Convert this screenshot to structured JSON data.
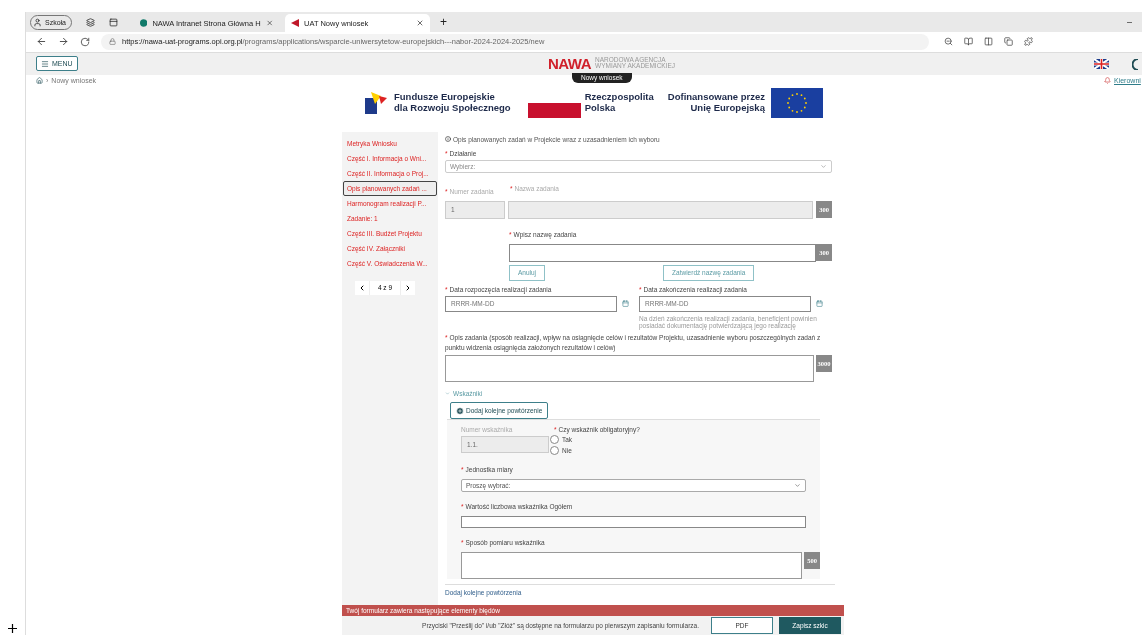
{
  "browser": {
    "profile": "Szkoła",
    "tabs": [
      {
        "title": "NAWA Intranet Strona Główna H",
        "kind": "intranet",
        "selected": false
      },
      {
        "title": "UAT Nowy wniosek",
        "kind": "nawa",
        "selected": true
      }
    ],
    "new_tab": "+",
    "minimize": "–",
    "url_host": "https://nawa-uat-programs.opi.org.pl",
    "url_path": "/programs/applications/wsparcie-uniwersytetow-europejskich---nabor-2024-2024-2025/new"
  },
  "header": {
    "menu": "MENU",
    "logo": "NAWA",
    "logo_sub": "NARODOWA AGENCJA WYMIANY AKADEMICKIEJ",
    "page_badge": "Nowy wniosek",
    "user_link": "Kierowni"
  },
  "breadcrumb": {
    "separator": "›",
    "current": "Nowy wniosek"
  },
  "funding_logos": {
    "program": [
      "Fundusze Europejskie",
      "dla Rozwoju Społecznego"
    ],
    "country": [
      "Rzeczpospolita",
      "Polska"
    ],
    "eu": [
      "Dofinansowane przez",
      "Unię Europejską"
    ]
  },
  "sidebar": {
    "items": [
      {
        "label": "Metryka Wniosku",
        "selected": false
      },
      {
        "label": "Część I. Informacja o Wni...",
        "selected": false
      },
      {
        "label": "Część II. Informacja o Proj...",
        "selected": false
      },
      {
        "label": "Opis planowanych zadań ...",
        "selected": true
      },
      {
        "label": "Harmonogram realizacji P...",
        "selected": false
      },
      {
        "label": "Zadanie: 1",
        "selected": false
      },
      {
        "label": "Część III. Budżet Projektu",
        "selected": false
      },
      {
        "label": "Część IV. Załączniki",
        "selected": false
      },
      {
        "label": "Część V. Oświadczenia W...",
        "selected": false
      }
    ],
    "pager": "4 z 9"
  },
  "form": {
    "section_title": "Opis planowanych zadań w Projekcie wraz z uzasadnieniem ich wyboru",
    "action": {
      "required_mark": "*",
      "label": "Działanie",
      "placeholder": "Wybierz:"
    },
    "task_number": {
      "required_mark": "*",
      "label": "Numer zadania",
      "value": "1",
      "disabled": true
    },
    "task_name": {
      "required_mark": "*",
      "label": "Nazwa zadania",
      "counter": "300",
      "disabled": true
    },
    "task_name_input": {
      "required_mark": "*",
      "label": "Wpisz nazwę zadania",
      "counter": "300",
      "disabled": false
    },
    "buttons": {
      "cancel": "Anuluj",
      "confirm": "Zatwierdź nazwę zadania"
    },
    "start_date": {
      "required_mark": "*",
      "label": "Data rozpoczęcia realizacji zadania",
      "placeholder": "RRRR-MM-DD"
    },
    "end_date": {
      "required_mark": "*",
      "label": "Data zakończenia realizacji zadania",
      "placeholder": "RRRR-MM-DD",
      "hint": "Na dzień zakończenia realizacji zadania, beneficjent powinien posiadać dokumentację potwierdzającą jego realizację"
    },
    "description": {
      "required_mark": "*",
      "label": "Opis zadania (sposób realizacji, wpływ na osiągnięcie celów i rezultatów Projektu, uzasadnienie wyboru poszczególnych zadań z punktu widzenia osiągnięcia założonych rezultatów i celów)",
      "counter": "3000"
    },
    "indicators": {
      "title": "Wskaźniki",
      "expanded": true,
      "add_button": "Dodaj kolejne powtórzenie",
      "number": {
        "label": "Numer wskaźnika",
        "value": "1.1."
      },
      "mandatory": {
        "required_mark": "*",
        "label": "Czy wskaźnik obligatoryjny?",
        "options": [
          {
            "label": "Tak",
            "selected": false
          },
          {
            "label": "Nie",
            "selected": false
          }
        ]
      },
      "unit": {
        "required_mark": "*",
        "label": "Jednostka miary",
        "placeholder": "Proszę wybrać:"
      },
      "value": {
        "required_mark": "*",
        "label": "Wartość liczbowa wskaźnika Ogółem"
      },
      "method": {
        "required_mark": "*",
        "label": "Sposób pomiaru wskaźnika",
        "counter": "500"
      },
      "add_link": "Dodaj kolejne powtórzenia"
    }
  },
  "error_bar": "Twój formularz zawiera następujące elementy błędów",
  "footer": {
    "note": "Przyciski \"Prześlij do\" i/ub \"Złóż\" są dostępne na formularzu po pierwszym zapisaniu formularza.",
    "pdf": "PDF",
    "save": "Zapisz szkic"
  }
}
